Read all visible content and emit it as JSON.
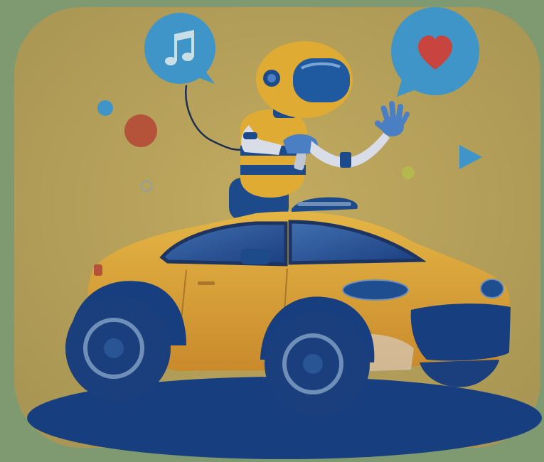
{
  "scene": {
    "subject": "robot-riding-car",
    "icons": {
      "music_bubble": "music-note-icon",
      "love_bubble": "heart-icon",
      "play_shape": "play-triangle-icon"
    },
    "colors": {
      "outer_background": "#7f9a70",
      "panel": "#b7a25c",
      "car_body": "#d9a838",
      "car_shadow": "#c07f2a",
      "navy": "#173e7e",
      "bubble_blue": "#3f95c7",
      "heart_red": "#c8453f",
      "robot_yellow": "#e0ab33",
      "visor_blue": "#1f5aa0",
      "glove_blue": "#4b7fc4"
    }
  }
}
